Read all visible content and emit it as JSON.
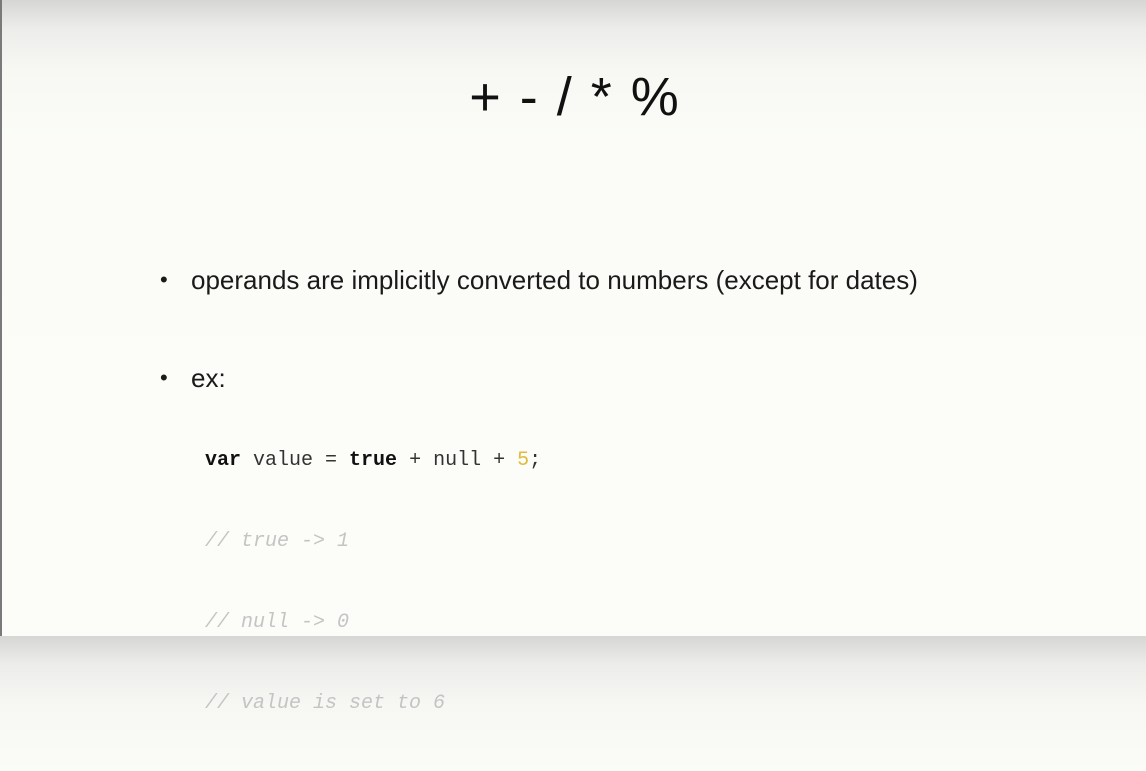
{
  "slide": {
    "title": "+ - / * %",
    "bullets": [
      {
        "marker": "•",
        "text": "operands are implicitly converted to numbers (except for dates)"
      },
      {
        "marker": "•",
        "text": "ex:"
      }
    ],
    "code": {
      "line1": {
        "kw_var": "var",
        "plain1": " value = ",
        "kw_true": "true",
        "plain2": " + null + ",
        "num": "5",
        "end": ";"
      },
      "comments": [
        "// true -> 1",
        "// null -> 0",
        "// value is set to 6"
      ]
    },
    "colors": {
      "number_literal": "#e0bc3a",
      "comment": "#c4c4c4",
      "text": "#141414"
    }
  }
}
